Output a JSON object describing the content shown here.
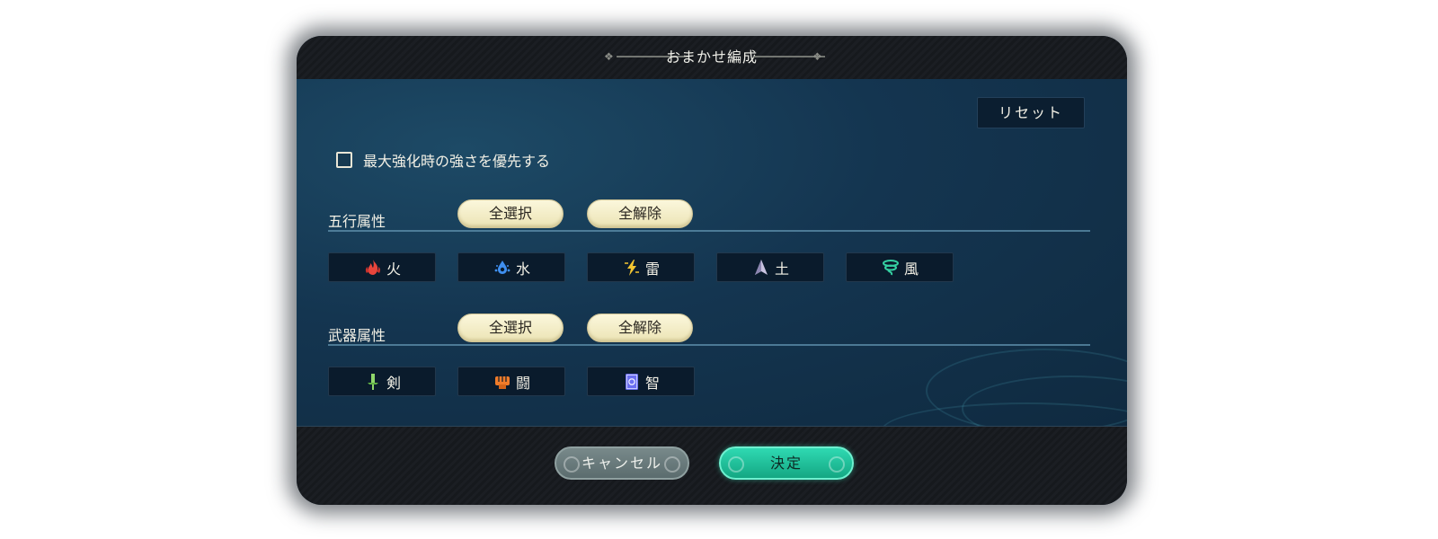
{
  "dialog": {
    "title": "おまかせ編成",
    "reset_label": "リセット",
    "checkbox": {
      "label": "最大強化時の強さを優先する",
      "checked": false
    }
  },
  "sections": [
    {
      "label": "五行属性",
      "select_all_label": "全選択",
      "deselect_all_label": "全解除",
      "options": [
        {
          "label": "火",
          "icon": "fire-icon",
          "color": "#e8453c"
        },
        {
          "label": "水",
          "icon": "water-icon",
          "color": "#3f8ff0"
        },
        {
          "label": "雷",
          "icon": "thunder-icon",
          "color": "#f2c531"
        },
        {
          "label": "土",
          "icon": "earth-icon",
          "color": "#c9c3e0"
        },
        {
          "label": "風",
          "icon": "wind-icon",
          "color": "#35d0a2"
        }
      ]
    },
    {
      "label": "武器属性",
      "select_all_label": "全選択",
      "deselect_all_label": "全解除",
      "options": [
        {
          "label": "剣",
          "icon": "sword-icon",
          "color": "#8fd66a"
        },
        {
          "label": "闘",
          "icon": "fist-icon",
          "color": "#f07c2a"
        },
        {
          "label": "智",
          "icon": "book-icon",
          "color": "#6b6ff0"
        }
      ]
    }
  ],
  "footer": {
    "cancel_label": "キャンセル",
    "ok_label": "決定"
  },
  "colors": {
    "accent": "#1fc79f",
    "pill": "#f5efc8",
    "panel": "#143550"
  }
}
